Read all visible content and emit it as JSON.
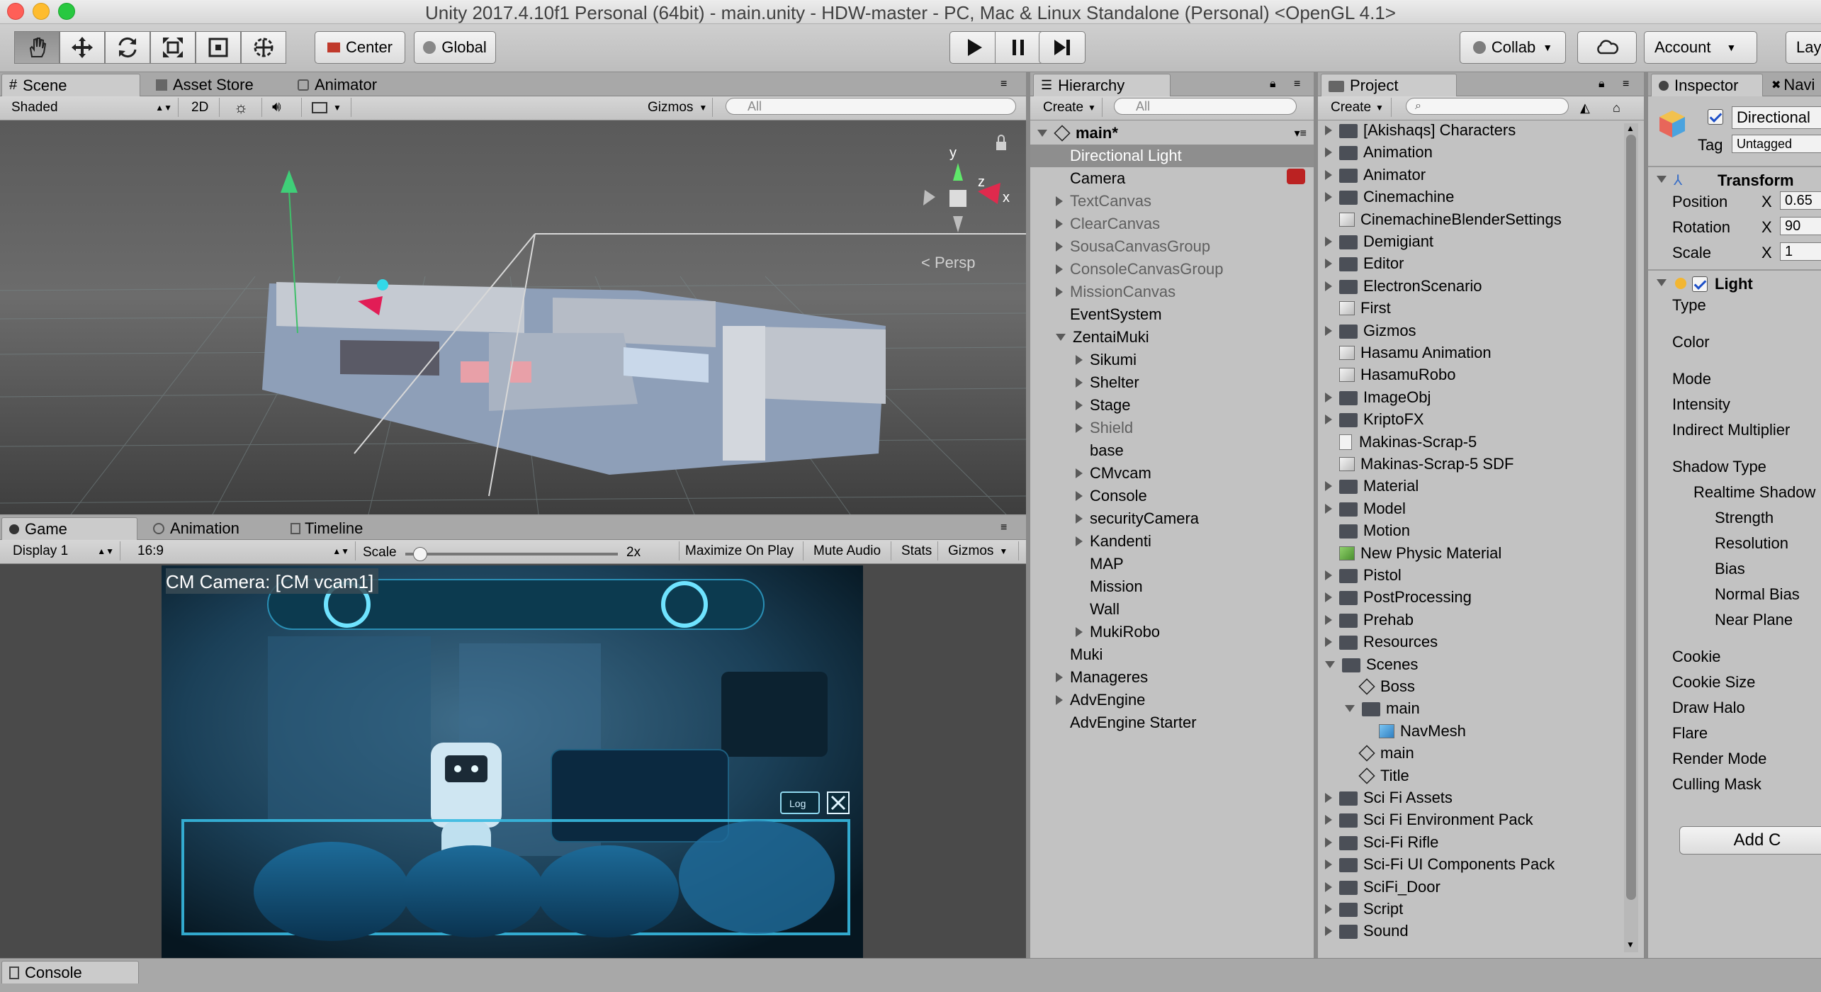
{
  "window": {
    "title": "Unity 2017.4.10f1 Personal (64bit) - main.unity - HDW-master - PC, Mac & Linux Standalone (Personal) <OpenGL 4.1>"
  },
  "toolbar": {
    "tools": [
      "hand-tool",
      "move-tool",
      "rotate-tool",
      "scale-tool",
      "rect-tool",
      "transform-tool"
    ],
    "pivot": "Center",
    "space": "Global",
    "collab": "Collab",
    "account": "Account",
    "layout": "Lay"
  },
  "scene_panel": {
    "tabs": [
      "Scene",
      "Asset Store",
      "Animator"
    ],
    "shading": "Shaded",
    "mode_2d": "2D",
    "gizmos": "Gizmos",
    "search_placeholder": "All",
    "persp": "< Persp",
    "axis_y": "y",
    "axis_z": "z",
    "axis_x": "x"
  },
  "game_panel": {
    "tabs": [
      "Game",
      "Animation",
      "Timeline"
    ],
    "display": "Display 1",
    "aspect": "16:9",
    "scale_label": "Scale",
    "scale_value": 0.07,
    "scale_text": "2x",
    "buttons": [
      "Maximize On Play",
      "Mute Audio",
      "Stats",
      "Gizmos"
    ],
    "overlay_title": "CM Camera: [CM vcam1]",
    "log_button": "Log"
  },
  "hierarchy": {
    "tab": "Hierarchy",
    "create": "Create",
    "search_placeholder": "All",
    "scene": "main*",
    "items": [
      {
        "label": "Directional Light",
        "depth": 0,
        "arrow": "none",
        "selected": true,
        "dim": false
      },
      {
        "label": "Camera",
        "depth": 0,
        "arrow": "none",
        "selected": false,
        "dim": false
      },
      {
        "label": "TextCanvas",
        "depth": 0,
        "arrow": "right",
        "selected": false,
        "dim": true
      },
      {
        "label": "ClearCanvas",
        "depth": 0,
        "arrow": "right",
        "selected": false,
        "dim": true
      },
      {
        "label": "SousaCanvasGroup",
        "depth": 0,
        "arrow": "right",
        "selected": false,
        "dim": true
      },
      {
        "label": "ConsoleCanvasGroup",
        "depth": 0,
        "arrow": "right",
        "selected": false,
        "dim": true
      },
      {
        "label": "MissionCanvas",
        "depth": 0,
        "arrow": "right",
        "selected": false,
        "dim": true
      },
      {
        "label": "EventSystem",
        "depth": 0,
        "arrow": "none",
        "selected": false,
        "dim": false
      },
      {
        "label": "ZentaiMuki",
        "depth": 0,
        "arrow": "down",
        "selected": false,
        "dim": false
      },
      {
        "label": "Sikumi",
        "depth": 1,
        "arrow": "right",
        "selected": false,
        "dim": false
      },
      {
        "label": "Shelter",
        "depth": 1,
        "arrow": "right",
        "selected": false,
        "dim": false
      },
      {
        "label": "Stage",
        "depth": 1,
        "arrow": "right",
        "selected": false,
        "dim": false
      },
      {
        "label": "Shield",
        "depth": 1,
        "arrow": "right",
        "selected": false,
        "dim": true
      },
      {
        "label": "base",
        "depth": 1,
        "arrow": "none",
        "selected": false,
        "dim": false
      },
      {
        "label": "CMvcam",
        "depth": 1,
        "arrow": "right",
        "selected": false,
        "dim": false
      },
      {
        "label": "Console",
        "depth": 1,
        "arrow": "right",
        "selected": false,
        "dim": false
      },
      {
        "label": "securityCamera",
        "depth": 1,
        "arrow": "right",
        "selected": false,
        "dim": false
      },
      {
        "label": "Kandenti",
        "depth": 1,
        "arrow": "right",
        "selected": false,
        "dim": false
      },
      {
        "label": "MAP",
        "depth": 1,
        "arrow": "none",
        "selected": false,
        "dim": false
      },
      {
        "label": "Mission",
        "depth": 1,
        "arrow": "none",
        "selected": false,
        "dim": false
      },
      {
        "label": "Wall",
        "depth": 1,
        "arrow": "none",
        "selected": false,
        "dim": false
      },
      {
        "label": "MukiRobo",
        "depth": 1,
        "arrow": "right",
        "selected": false,
        "dim": false
      },
      {
        "label": "Muki",
        "depth": 0,
        "arrow": "none",
        "selected": false,
        "dim": false
      },
      {
        "label": "Manageres",
        "depth": 0,
        "arrow": "right",
        "selected": false,
        "dim": false
      },
      {
        "label": "AdvEngine",
        "depth": 0,
        "arrow": "right",
        "selected": false,
        "dim": false
      },
      {
        "label": "AdvEngine Starter",
        "depth": 0,
        "arrow": "none",
        "selected": false,
        "dim": false
      }
    ]
  },
  "project": {
    "tab": "Project",
    "create": "Create",
    "items": [
      {
        "label": "[Akishaqs] Characters",
        "depth": 0,
        "arrow": "right",
        "icon": "folder"
      },
      {
        "label": "Animation",
        "depth": 0,
        "arrow": "right",
        "icon": "folder"
      },
      {
        "label": "Animator",
        "depth": 0,
        "arrow": "right",
        "icon": "folder"
      },
      {
        "label": "Cinemachine",
        "depth": 0,
        "arrow": "right",
        "icon": "folder"
      },
      {
        "label": "CinemachineBlenderSettings",
        "depth": 0,
        "arrow": "none",
        "icon": "asset"
      },
      {
        "label": "Demigiant",
        "depth": 0,
        "arrow": "right",
        "icon": "folder"
      },
      {
        "label": "Editor",
        "depth": 0,
        "arrow": "right",
        "icon": "folder"
      },
      {
        "label": "ElectronScenario",
        "depth": 0,
        "arrow": "right",
        "icon": "folder"
      },
      {
        "label": "First",
        "depth": 0,
        "arrow": "none",
        "icon": "asset"
      },
      {
        "label": "Gizmos",
        "depth": 0,
        "arrow": "right",
        "icon": "folder"
      },
      {
        "label": "Hasamu Animation",
        "depth": 0,
        "arrow": "none",
        "icon": "asset"
      },
      {
        "label": "HasamuRobo",
        "depth": 0,
        "arrow": "none",
        "icon": "asset"
      },
      {
        "label": "ImageObj",
        "depth": 0,
        "arrow": "right",
        "icon": "folder"
      },
      {
        "label": "KriptoFX",
        "depth": 0,
        "arrow": "right",
        "icon": "folder"
      },
      {
        "label": "Makinas-Scrap-5",
        "depth": 0,
        "arrow": "none",
        "icon": "file"
      },
      {
        "label": "Makinas-Scrap-5 SDF",
        "depth": 0,
        "arrow": "none",
        "icon": "asset"
      },
      {
        "label": "Material",
        "depth": 0,
        "arrow": "right",
        "icon": "folder"
      },
      {
        "label": "Model",
        "depth": 0,
        "arrow": "right",
        "icon": "folder"
      },
      {
        "label": "Motion",
        "depth": 0,
        "arrow": "none",
        "icon": "folder"
      },
      {
        "label": "New Physic Material",
        "depth": 0,
        "arrow": "none",
        "icon": "physic"
      },
      {
        "label": "Pistol",
        "depth": 0,
        "arrow": "right",
        "icon": "folder"
      },
      {
        "label": "PostProcessing",
        "depth": 0,
        "arrow": "right",
        "icon": "folder"
      },
      {
        "label": "Prehab",
        "depth": 0,
        "arrow": "right",
        "icon": "folder"
      },
      {
        "label": "Resources",
        "depth": 0,
        "arrow": "right",
        "icon": "folder"
      },
      {
        "label": "Scenes",
        "depth": 0,
        "arrow": "down",
        "icon": "folder"
      },
      {
        "label": "Boss",
        "depth": 1,
        "arrow": "none",
        "icon": "unity"
      },
      {
        "label": "main",
        "depth": 1,
        "arrow": "down",
        "icon": "folder"
      },
      {
        "label": "NavMesh",
        "depth": 2,
        "arrow": "none",
        "icon": "navmesh"
      },
      {
        "label": "main",
        "depth": 1,
        "arrow": "none",
        "icon": "unity"
      },
      {
        "label": "Title",
        "depth": 1,
        "arrow": "none",
        "icon": "unity"
      },
      {
        "label": "Sci Fi Assets",
        "depth": 0,
        "arrow": "right",
        "icon": "folder"
      },
      {
        "label": "Sci Fi Environment Pack",
        "depth": 0,
        "arrow": "right",
        "icon": "folder"
      },
      {
        "label": "Sci-Fi Rifle",
        "depth": 0,
        "arrow": "right",
        "icon": "folder"
      },
      {
        "label": "Sci-Fi UI Components Pack",
        "depth": 0,
        "arrow": "right",
        "icon": "folder"
      },
      {
        "label": "SciFi_Door",
        "depth": 0,
        "arrow": "right",
        "icon": "folder"
      },
      {
        "label": "Script",
        "depth": 0,
        "arrow": "right",
        "icon": "folder"
      },
      {
        "label": "Sound",
        "depth": 0,
        "arrow": "right",
        "icon": "folder"
      }
    ]
  },
  "inspector": {
    "tabs": [
      "Inspector",
      "Navi"
    ],
    "object_name": "Directional",
    "tag_label": "Tag",
    "tag_value": "Untagged",
    "transform": {
      "title": "Transform",
      "rows": [
        {
          "label": "Position",
          "axis": "X",
          "value": "0.65"
        },
        {
          "label": "Rotation",
          "axis": "X",
          "value": "90"
        },
        {
          "label": "Scale",
          "axis": "X",
          "value": "1"
        }
      ]
    },
    "light": {
      "title": "Light",
      "props": [
        "Type",
        "Color",
        "Mode",
        "Intensity",
        "Indirect Multiplier",
        "Shadow Type",
        "Realtime Shadow",
        "Strength",
        "Resolution",
        "Bias",
        "Normal Bias",
        "Near Plane",
        "Cookie",
        "Cookie Size",
        "Draw Halo",
        "Flare",
        "Render Mode",
        "Culling Mask"
      ]
    },
    "add_component": "Add C"
  },
  "console": {
    "tab": "Console"
  },
  "colors": {
    "selection": "#8e8e8e",
    "panel": "#c2c2c2",
    "scene_bg": "#4d4d4d",
    "game_bg": "#0a2533"
  }
}
